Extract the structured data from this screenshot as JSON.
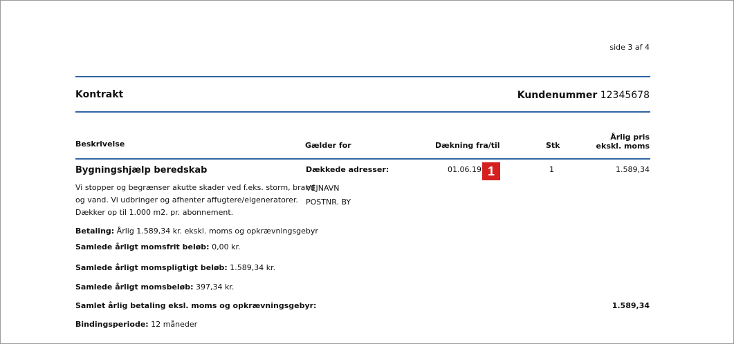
{
  "header": {
    "page_indicator": "side 3 af 4",
    "title": "Kontrakt",
    "customer_label": "Kundenummer",
    "customer_number": "12345678"
  },
  "table": {
    "columns": {
      "description": "Beskrivelse",
      "applies_to": "Gælder for",
      "coverage": "Dækning fra/til",
      "qty": "Stk",
      "price_line1": "Årlig pris",
      "price_line2": "ekskl. moms"
    },
    "row": {
      "name": "Bygningshjælp beredskab",
      "description_lines": [
        "Vi stopper og begrænser akutte skader ved f.eks. storm, brand",
        "og vand. Vi udbringer og afhenter affugtere/elgeneratorer.",
        "Dækker op til 1.000 m2. pr. abonnement."
      ],
      "covered_label": "Dækkede adresser:",
      "address_lines": [
        "VEJNAVN",
        "POSTNR. BY"
      ],
      "coverage_from": "01.06.19",
      "qty": "1",
      "price": "1.589,34"
    }
  },
  "marker": {
    "number": "1",
    "color": "#d6201f"
  },
  "summary": {
    "payment_label": "Betaling:",
    "payment_value": "Årlig 1.589,34 kr. ekskl. moms og opkrævningsgebyr",
    "vat_free_label": "Samlede årligt momsfrit beløb:",
    "vat_free_value": "0,00 kr.",
    "vat_liable_label": "Samlede årligt momspligtigt beløb:",
    "vat_liable_value": "1.589,34 kr.",
    "vat_label": "Samlede årligt momsbeløb:",
    "vat_value": "397,34 kr.",
    "total_label": "Samlet årlig betaling eksl. moms og opkrævningsgebyr:",
    "total_value": "1.589,34",
    "binding_label": "Bindingsperiode:",
    "binding_value": "12 måneder"
  },
  "colors": {
    "rule": "#2f64a3",
    "border": "#9a9a9a"
  }
}
